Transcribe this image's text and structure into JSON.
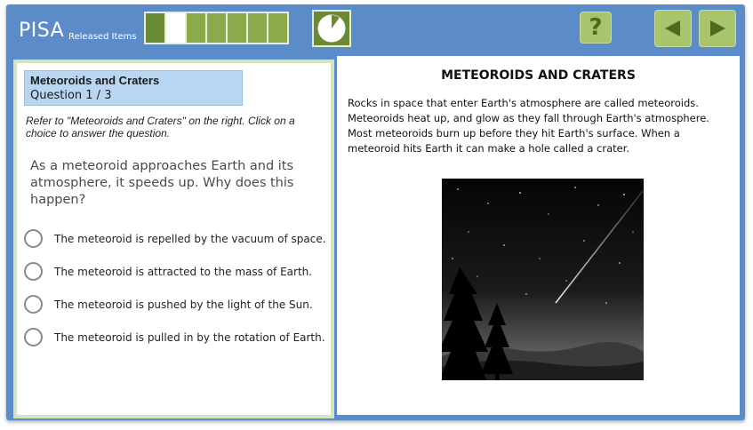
{
  "header": {
    "brand": "PISA",
    "brand_sub": "Released Items",
    "progress": {
      "total": 7,
      "completed": 1,
      "current": 2
    },
    "timer": {
      "elapsed_fraction": 0.1
    },
    "help_label": "?",
    "icons": {
      "help": "question-mark-icon",
      "prev": "triangle-left-icon",
      "next": "triangle-right-icon",
      "timer": "pie-clock-icon"
    }
  },
  "question": {
    "unit_title": "Meteoroids and Craters",
    "number": "Question 1 / 3",
    "instruction": "Refer to \"Meteoroids and Craters\" on the right. Click on a choice to answer the question.",
    "prompt": "As a meteoroid approaches Earth and its atmosphere, it speeds up. Why does this happen?",
    "choices": [
      "The meteoroid is repelled by the vacuum of space.",
      "The meteoroid is attracted to the mass of Earth.",
      "The meteoroid is pushed by the light of the Sun.",
      "The meteoroid is pulled in by the rotation of Earth."
    ]
  },
  "stimulus": {
    "title": "METEOROIDS AND CRATERS",
    "passage": "Rocks in space that enter Earth's atmosphere are called meteoroids. Meteoroids heat up, and glow as they fall through Earth's atmosphere. Most meteoroids burn up before they hit Earth's surface. When a meteoroid hits Earth it can make a hole called a crater.",
    "image": "night-sky-meteor-over-pine-trees"
  },
  "colors": {
    "frame": "#5b8cc9",
    "button_green": "#a8c46c",
    "progress_green": "#8aaa4c",
    "header_blue": "#b8d6f2"
  }
}
